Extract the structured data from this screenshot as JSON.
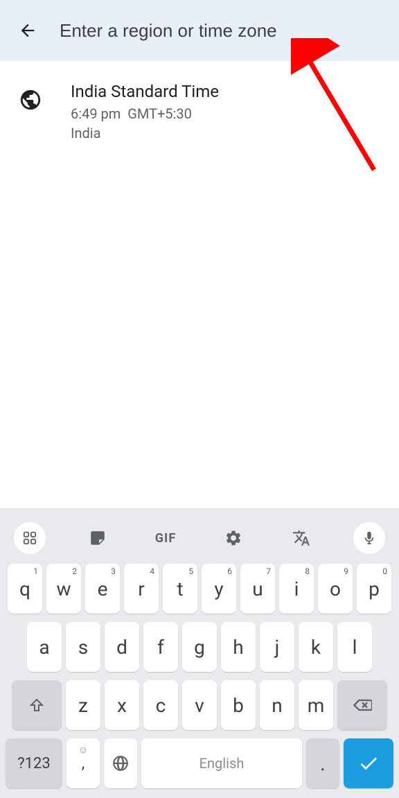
{
  "header": {
    "placeholder": "Enter a region or time zone"
  },
  "result": {
    "title": "India Standard Time",
    "time": "6:49 pm",
    "offset": "GMT+5:30",
    "region": "India"
  },
  "keyboard": {
    "toolbar": {
      "gif": "GIF"
    },
    "row1": [
      {
        "k": "q",
        "s": "1"
      },
      {
        "k": "w",
        "s": "2"
      },
      {
        "k": "e",
        "s": "3"
      },
      {
        "k": "r",
        "s": "4"
      },
      {
        "k": "t",
        "s": "5"
      },
      {
        "k": "y",
        "s": "6"
      },
      {
        "k": "u",
        "s": "7"
      },
      {
        "k": "i",
        "s": "8"
      },
      {
        "k": "o",
        "s": "9"
      },
      {
        "k": "p",
        "s": "0"
      }
    ],
    "row2": [
      "a",
      "s",
      "d",
      "f",
      "g",
      "h",
      "j",
      "k",
      "l"
    ],
    "row3": [
      "z",
      "x",
      "c",
      "v",
      "b",
      "n",
      "m"
    ],
    "symKey": "?123",
    "commaTop": "☺",
    "comma": ",",
    "space": "English",
    "period": "."
  }
}
